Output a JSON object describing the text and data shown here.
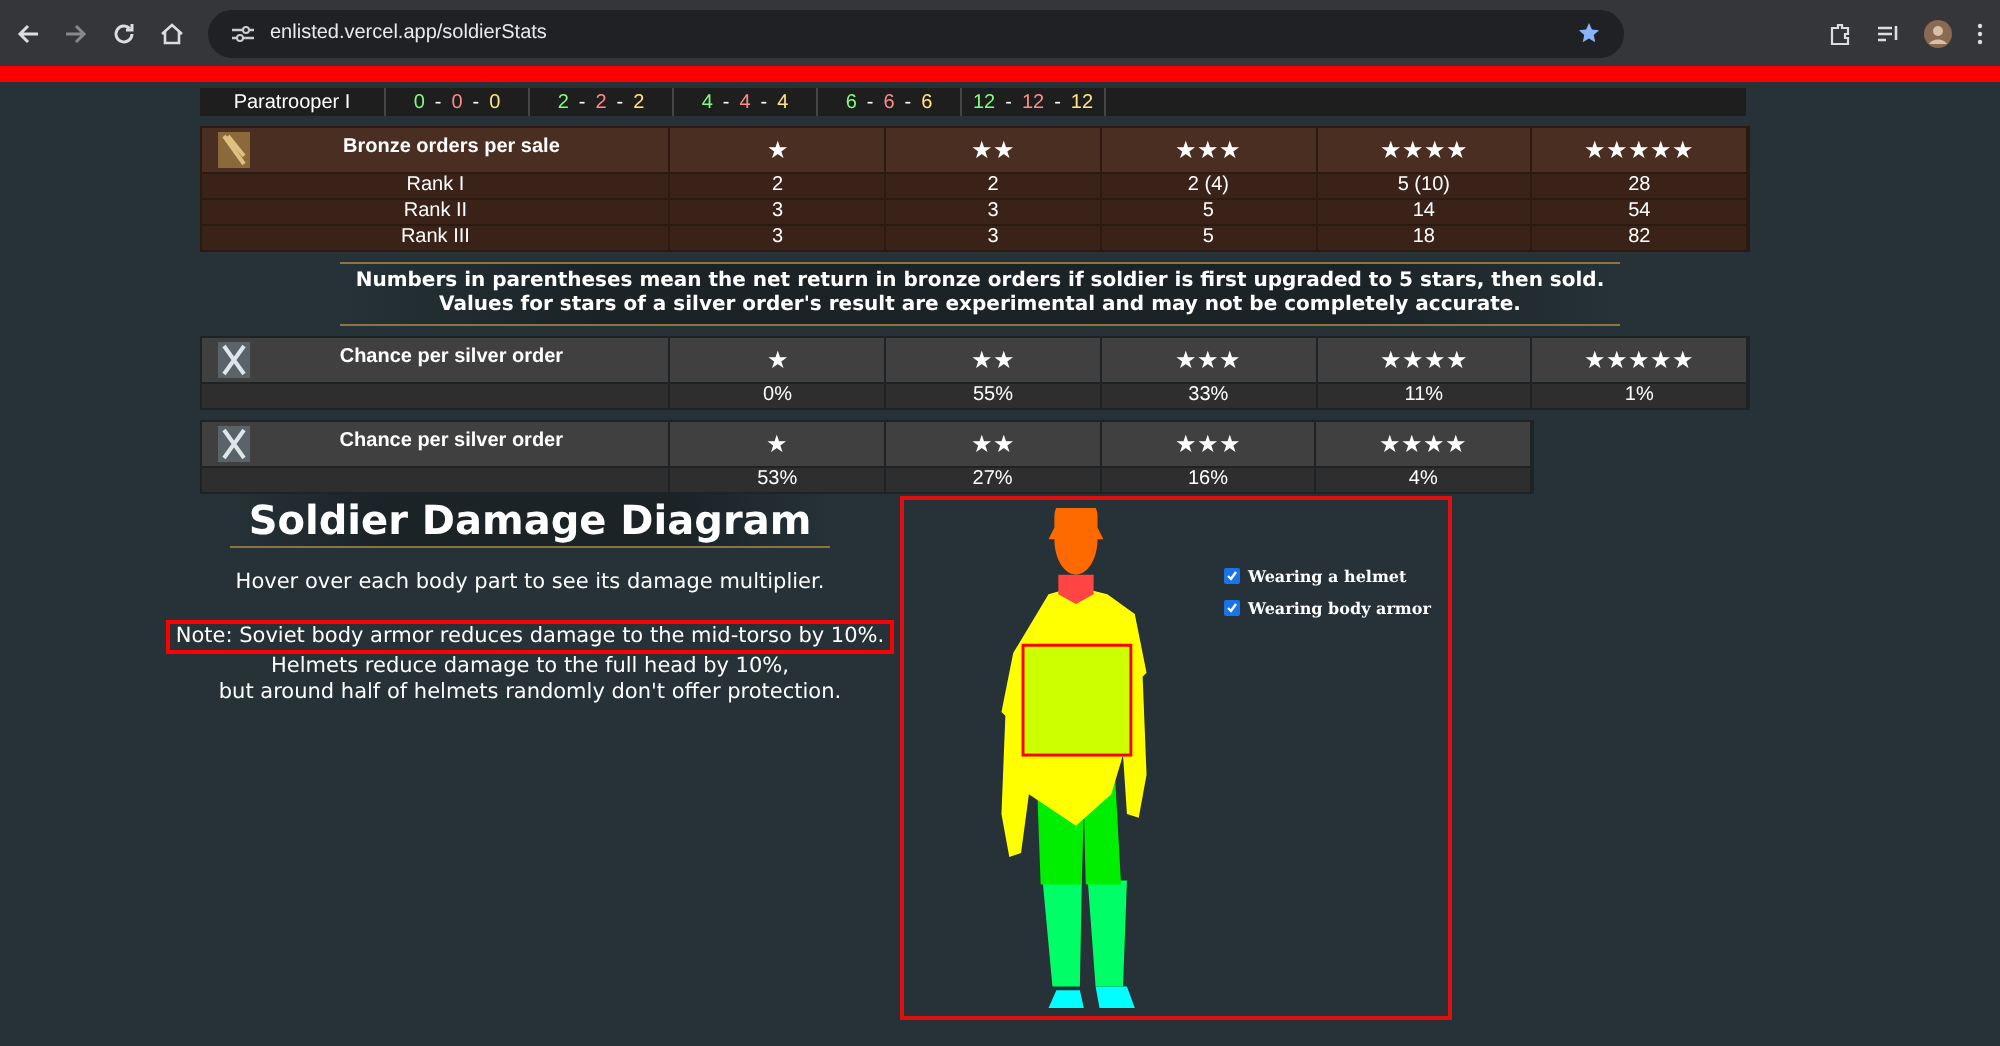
{
  "browser": {
    "url": "enlisted.vercel.app/soldierStats"
  },
  "level_row": {
    "label": "Paratrooper I",
    "groups": [
      [
        {
          "text": "0",
          "color": "#7dff7d"
        },
        {
          "text": "-",
          "color": "#ffffff"
        },
        {
          "text": "0",
          "color": "#ff8a8a"
        },
        {
          "text": "-",
          "color": "#ffffff"
        },
        {
          "text": "0",
          "color": "#ffe680"
        }
      ],
      [
        {
          "text": "2",
          "color": "#7dff7d"
        },
        {
          "text": "-",
          "color": "#ffffff"
        },
        {
          "text": "2",
          "color": "#ff8a8a"
        },
        {
          "text": "-",
          "color": "#ffffff"
        },
        {
          "text": "2",
          "color": "#ffe680"
        }
      ],
      [
        {
          "text": "4",
          "color": "#7dff7d"
        },
        {
          "text": "-",
          "color": "#ffffff"
        },
        {
          "text": "4",
          "color": "#ff8a8a"
        },
        {
          "text": "-",
          "color": "#ffffff"
        },
        {
          "text": "4",
          "color": "#ffe680"
        }
      ],
      [
        {
          "text": "6",
          "color": "#7dff7d"
        },
        {
          "text": "-",
          "color": "#ffffff"
        },
        {
          "text": "6",
          "color": "#ff8a8a"
        },
        {
          "text": "-",
          "color": "#ffffff"
        },
        {
          "text": "6",
          "color": "#ffe680"
        }
      ],
      [
        {
          "text": "12",
          "color": "#7dff7d"
        },
        {
          "text": "-",
          "color": "#ffffff"
        },
        {
          "text": "12",
          "color": "#ff8a8a"
        },
        {
          "text": "-",
          "color": "#ffffff"
        },
        {
          "text": "12",
          "color": "#ffe680"
        }
      ]
    ]
  },
  "tables": [
    {
      "kind": "bronze",
      "title": "Bronze orders per sale",
      "columns": [
        "★",
        "★★",
        "★★★",
        "★★★★",
        "★★★★★"
      ],
      "rows": [
        {
          "label": "Rank I",
          "cells": [
            "2",
            "2",
            "2 (4)",
            "5 (10)",
            "28"
          ]
        },
        {
          "label": "Rank II",
          "cells": [
            "3",
            "3",
            "5",
            "14",
            "54"
          ]
        },
        {
          "label": "Rank III",
          "cells": [
            "3",
            "3",
            "5",
            "18",
            "82"
          ]
        }
      ]
    },
    {
      "kind": "note",
      "lines": [
        "Numbers in parentheses mean the net return in bronze orders if soldier is first upgraded to 5 stars, then sold.",
        "Values for stars of a silver order's result are experimental and may not be completely accurate."
      ]
    },
    {
      "kind": "silver",
      "title": "Chance per silver order",
      "columns": [
        "★",
        "★★",
        "★★★",
        "★★★★",
        "★★★★★"
      ],
      "rows": [
        {
          "label": "",
          "cells": [
            "0%",
            "55%",
            "33%",
            "11%",
            "1%"
          ]
        }
      ]
    },
    {
      "kind": "silver",
      "title": "Chance per silver order",
      "columns": [
        "★",
        "★★",
        "★★★",
        "★★★★"
      ],
      "rows": [
        {
          "label": "",
          "cells": [
            "53%",
            "27%",
            "16%",
            "4%"
          ]
        }
      ]
    }
  ],
  "diagram": {
    "title": "Soldier Damage Diagram",
    "hint": "Hover over each body part to see its damage multiplier.",
    "notes": [
      "Note: Soviet body armor reduces damage to the mid-torso by 10%.",
      "Helmets reduce damage to the full head by 10%,",
      "but around half of helmets randomly don't offer protection."
    ],
    "options": [
      {
        "label": "Wearing a helmet",
        "checked": true
      },
      {
        "label": "Wearing body armor",
        "checked": true
      }
    ]
  }
}
